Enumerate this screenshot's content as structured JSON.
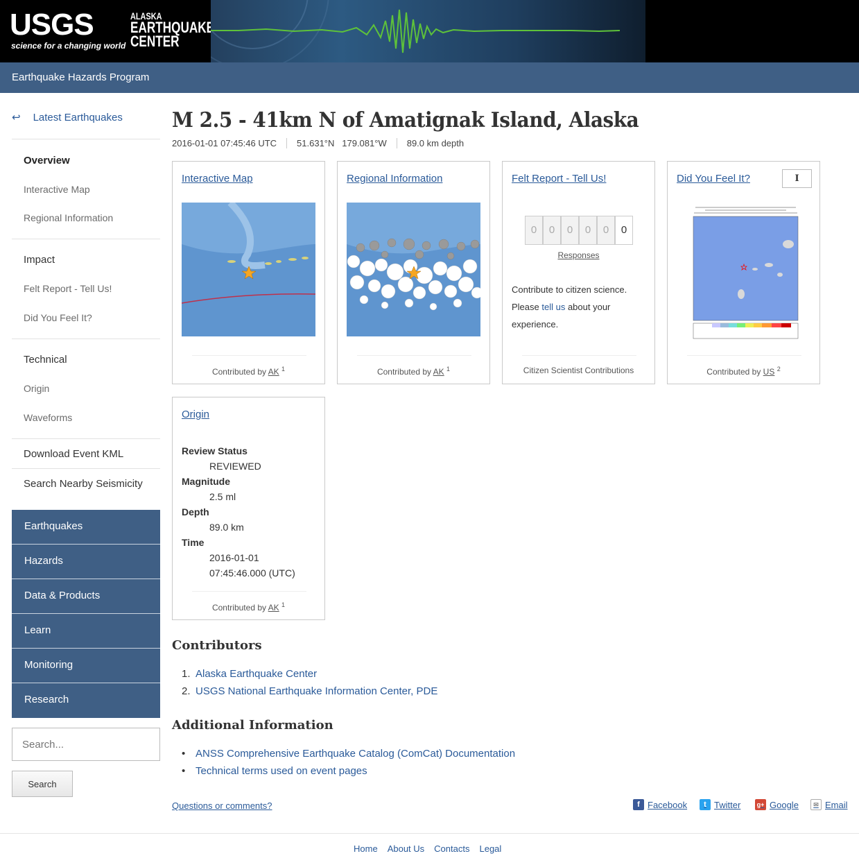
{
  "header": {
    "logo_text": "USGS",
    "logo_tagline": "science for a changing world",
    "center_line1": "ALASKA",
    "center_line2": "EARTHQUAKE",
    "center_line3": "CENTER",
    "program": "Earthquake Hazards Program"
  },
  "sidebar": {
    "back_label": "Latest Earthquakes",
    "overview": "Overview",
    "interactive_map": "Interactive Map",
    "regional_information": "Regional Information",
    "impact": "Impact",
    "felt_report": "Felt Report - Tell Us!",
    "did_you_feel_it": "Did You Feel It?",
    "technical": "Technical",
    "origin": "Origin",
    "waveforms": "Waveforms",
    "download_kml": "Download Event KML",
    "search_nearby": "Search Nearby Seismicity",
    "menu": [
      "Earthquakes",
      "Hazards",
      "Data & Products",
      "Learn",
      "Monitoring",
      "Research"
    ],
    "search_placeholder": "Search...",
    "search_button": "Search"
  },
  "event": {
    "title": "M 2.5 - 41km N of Amatignak Island, Alaska",
    "time": "2016-01-01 07:45:46 UTC",
    "lat": "51.631°N",
    "lon": "179.081°W",
    "depth": "89.0 km depth"
  },
  "cards": {
    "interactive_map": {
      "title": "Interactive Map",
      "contrib_prefix": "Contributed by",
      "contrib_source": "AK",
      "contrib_ref": "1"
    },
    "regional": {
      "title": "Regional Information",
      "contrib_prefix": "Contributed by",
      "contrib_source": "AK",
      "contrib_ref": "1"
    },
    "felt": {
      "title": "Felt Report - Tell Us!",
      "counter": [
        "0",
        "0",
        "0",
        "0",
        "0",
        "0"
      ],
      "responses": "Responses",
      "text1": "Contribute to citizen science. Please ",
      "link": "tell us",
      "text2": " about your experience.",
      "footer": "Citizen Scientist Contributions"
    },
    "dyfi": {
      "title": "Did You Feel It?",
      "button": "I",
      "contrib_prefix": "Contributed by",
      "contrib_source": "US",
      "contrib_ref": "2"
    },
    "origin": {
      "title": "Origin",
      "review_status_label": "Review Status",
      "review_status": "REVIEWED",
      "magnitude_label": "Magnitude",
      "magnitude": "2.5 ml",
      "depth_label": "Depth",
      "depth": "89.0 km",
      "time_label": "Time",
      "time_date": "2016-01-01",
      "time_clock": "07:45:46.000 (UTC)",
      "contrib_prefix": "Contributed by",
      "contrib_source": "AK",
      "contrib_ref": "1"
    }
  },
  "contributors": {
    "heading": "Contributors",
    "items": [
      "Alaska Earthquake Center",
      "USGS National Earthquake Information Center, PDE"
    ]
  },
  "additional": {
    "heading": "Additional Information",
    "items": [
      "ANSS Comprehensive Earthquake Catalog (ComCat) Documentation",
      "Technical terms used on event pages"
    ]
  },
  "footer": {
    "questions": "Questions or comments?",
    "facebook": "Facebook",
    "twitter": "Twitter",
    "google": "Google",
    "email": "Email",
    "links": [
      "Home",
      "About Us",
      "Contacts",
      "Legal"
    ]
  },
  "colors": {
    "nav_blue": "#3f5f85",
    "link": "#2a5a99"
  }
}
